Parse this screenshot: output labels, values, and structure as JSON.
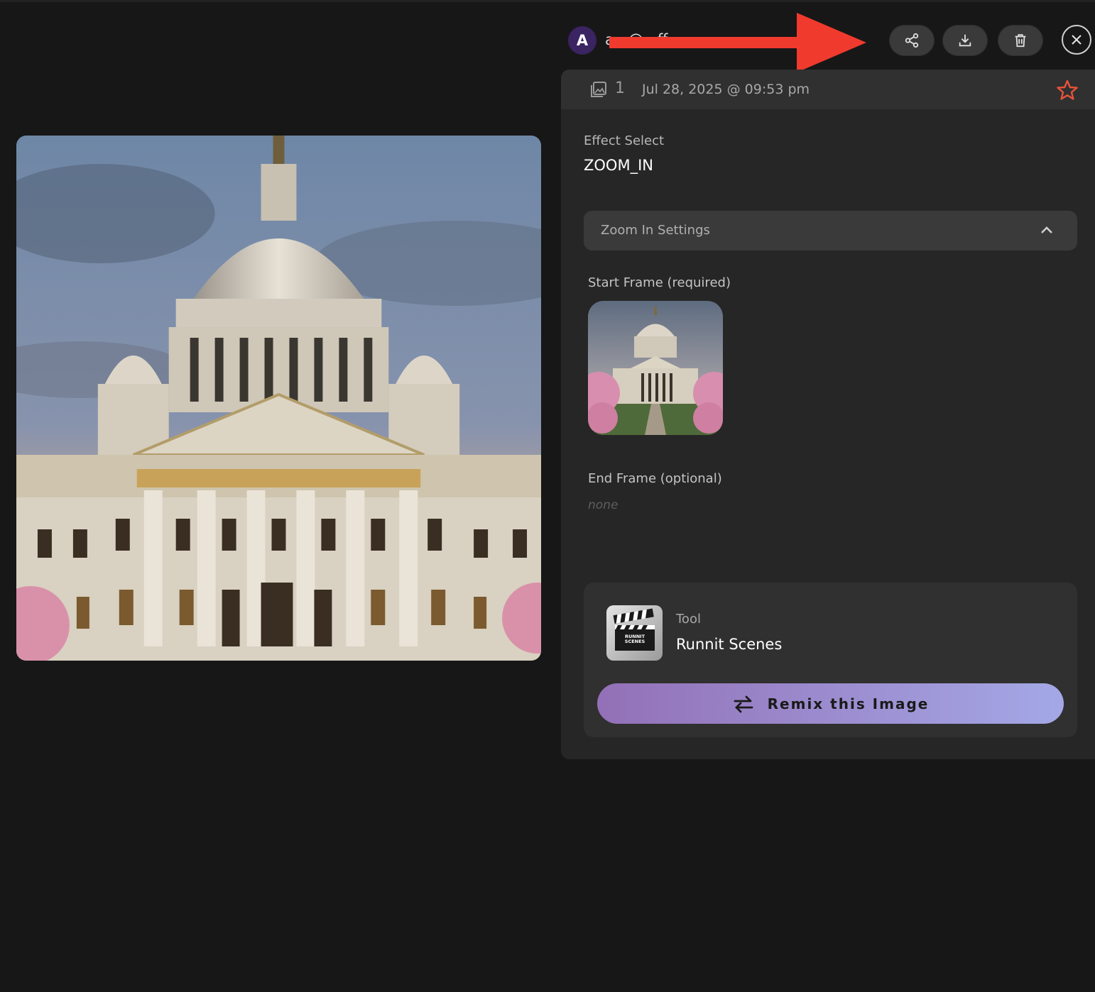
{
  "header": {
    "avatar_initial": "A",
    "username": "a...@...ff...",
    "buttons": {
      "share": "share-icon",
      "download": "download-icon",
      "delete": "trash-icon",
      "close": "close-icon"
    }
  },
  "meta": {
    "image_count": "1",
    "date": "Jul 28, 2025 @ 09:53 pm",
    "star_color": "#e8533a"
  },
  "effect": {
    "label": "Effect Select",
    "value": "ZOOM_IN"
  },
  "settings": {
    "label": "Zoom In Settings"
  },
  "start_frame": {
    "label": "Start Frame (required)"
  },
  "end_frame": {
    "label": "End Frame (optional)",
    "value": "none"
  },
  "tool": {
    "label": "Tool",
    "name": "Runnit Scenes",
    "icon_text_line1": "RUNNIT",
    "icon_text_line2": "SCENES"
  },
  "remix": {
    "label": "Remix this Image"
  },
  "colors": {
    "accent_start": "#9370b7",
    "accent_end": "#a4a8e6",
    "arrow": "#f03a2e"
  }
}
